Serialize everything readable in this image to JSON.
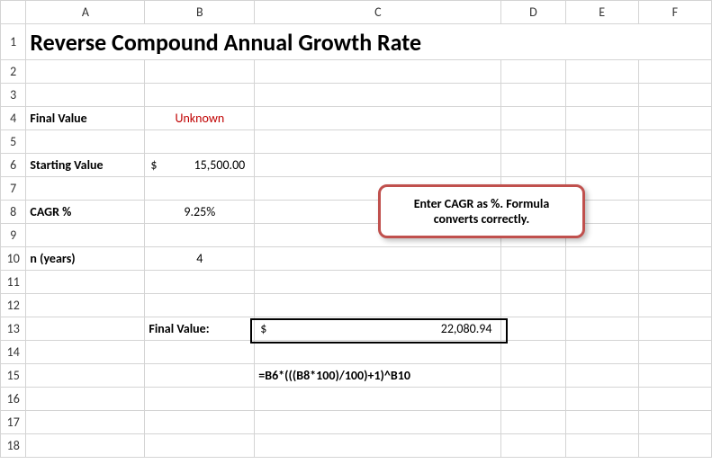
{
  "columns": [
    "A",
    "B",
    "C",
    "D",
    "E",
    "F"
  ],
  "rows": [
    "1",
    "2",
    "3",
    "4",
    "5",
    "6",
    "7",
    "8",
    "9",
    "10",
    "11",
    "12",
    "13",
    "14",
    "15",
    "16",
    "17",
    "18"
  ],
  "title": "Reverse Compound Annual Growth Rate",
  "labels": {
    "finalValue": "Final Value",
    "startingValue": "Starting Value",
    "cagrPercent": "CAGR %",
    "nYears": "n (years)",
    "finalValueResultLabel": "Final Value:"
  },
  "values": {
    "finalValueInput": "Unknown",
    "startingValueSymbol": "$",
    "startingValue": "15,500.00",
    "cagr": "9.25%",
    "nYears": "4",
    "resultSymbol": "$",
    "resultValue": "22,080.94",
    "formulaText": "=B6*(((B8*100)/100)+1)^B10"
  },
  "callout": "Enter CAGR as %. Formula converts correctly.",
  "chart_data": {
    "type": "table",
    "title": "Reverse Compound Annual Growth Rate",
    "inputs": {
      "starting_value": 15500.0,
      "cagr_percent": 9.25,
      "n_years": 4
    },
    "output": {
      "final_value": 22080.94
    },
    "formula": "=B6*(((B8*100)/100)+1)^B10"
  }
}
